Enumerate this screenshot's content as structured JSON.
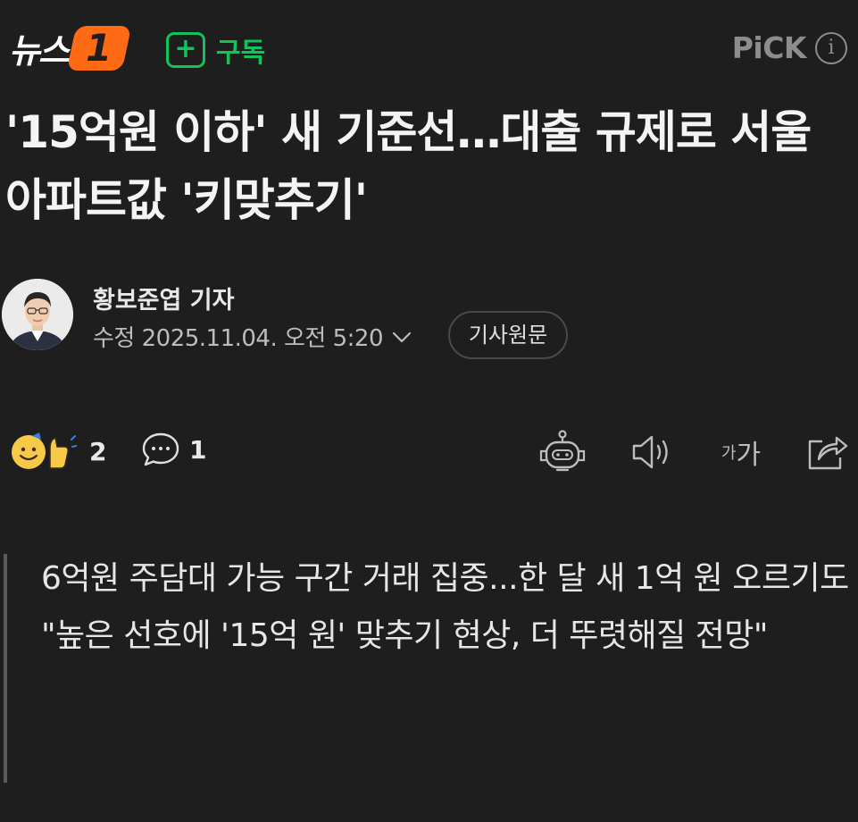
{
  "header": {
    "brand_text": "뉴스",
    "brand_badge": "1",
    "subscribe_label": "구독",
    "pick_label": "PiCK",
    "info_label": "i"
  },
  "article": {
    "headline": "'15억원 이하' 새 기준선…대출 규제로 서울 아파트값 '키맞추기'",
    "reporter": "황보준엽 기자",
    "date": "수정 2025.11.04. 오전 5:20",
    "original_label": "기사원문"
  },
  "actions": {
    "reaction_count": "2",
    "comment_count": "1",
    "font_small": "가",
    "font_big": "가"
  },
  "summary": [
    "6억원 주담대 가능 구간 거래 집중...한 달 새 1억 원 오르기도",
    "\"높은 선호에 '15억 원' 맞추기 현상, 더 뚜렷해질 전망\""
  ],
  "colors": {
    "background": "#1e1e1e",
    "brand_orange": "#ff6a14",
    "subscribe_green": "#13c25a",
    "muted": "#8d8d8d"
  }
}
